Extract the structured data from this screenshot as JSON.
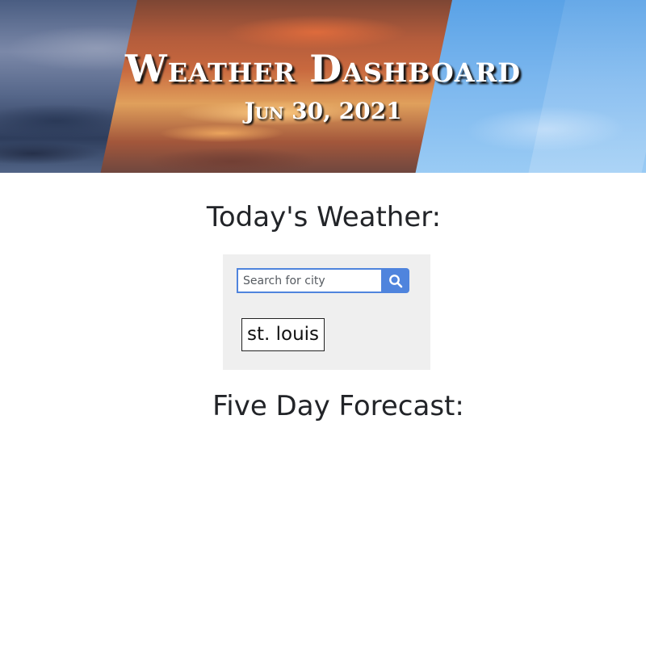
{
  "header": {
    "title": "Weather Dashboard",
    "date": "Jun 30, 2021"
  },
  "today": {
    "heading": "Today's Weather:"
  },
  "search": {
    "placeholder": "Search for city",
    "value": "",
    "button_icon": "search-icon",
    "button_color": "#4f84dd"
  },
  "history": {
    "items": [
      {
        "label": "st. louis"
      }
    ]
  },
  "forecast": {
    "heading": "Five Day Forecast:"
  }
}
